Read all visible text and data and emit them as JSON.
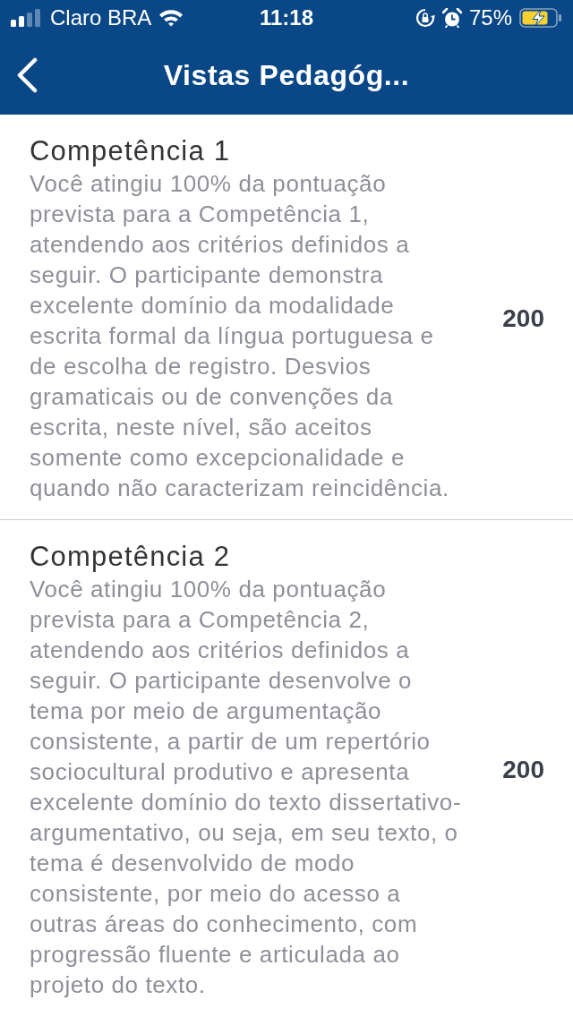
{
  "status_bar": {
    "carrier": "Claro BRA",
    "time": "11:18",
    "battery_percent": "75%",
    "charging": true
  },
  "nav_bar": {
    "title": "Vistas Pedagóg..."
  },
  "competencies": [
    {
      "title": "Competência 1",
      "description": "Você atingiu 100% da pontuação prevista para a Competência 1, atendendo aos critérios definidos a seguir. O participante demonstra excelente domínio da modalidade escrita formal da língua portuguesa e de escolha de registro. Desvios gramaticais ou de convenções da escrita, neste nível, são aceitos somente como excepcionalidade e quando não caracterizam reincidência.",
      "score": "200"
    },
    {
      "title": "Competência 2",
      "description": "Você atingiu 100% da pontuação prevista para a Competência 2, atendendo aos critérios definidos a seguir. O participante desenvolve o tema por meio de argumentação consistente, a partir de um repertório sociocultural produtivo e apresenta excelente domínio do texto dissertativo-argumentativo, ou seja, em seu texto, o tema é desenvolvido de modo consistente, por meio do acesso a outras áreas do conhecimento, com progressão fluente e articulada ao projeto do texto.",
      "score": "200"
    }
  ]
}
